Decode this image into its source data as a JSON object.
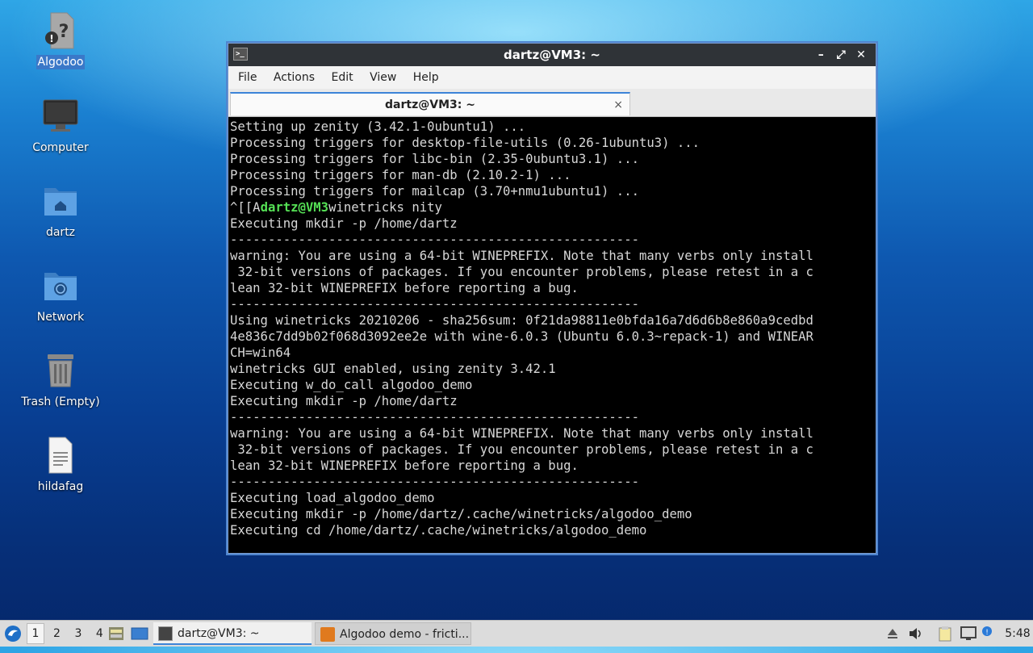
{
  "desktop": {
    "icons": [
      {
        "label": "Algodoo"
      },
      {
        "label": "Computer"
      },
      {
        "label": "dartz"
      },
      {
        "label": "Network"
      },
      {
        "label": "Trash (Empty)"
      },
      {
        "label": "hildafag"
      }
    ]
  },
  "window": {
    "title": "dartz@VM3: ~",
    "menu": [
      "File",
      "Actions",
      "Edit",
      "View",
      "Help"
    ],
    "tab_title": "dartz@VM3: ~",
    "tab_close": "×",
    "controls": {
      "minimize": "–",
      "maximize": "⤢",
      "close": "✕"
    }
  },
  "terminal": {
    "lines_before": [
      "Setting up zenity (3.42.1-0ubuntu1) ...",
      "Processing triggers for desktop-file-utils (0.26-1ubuntu3) ...",
      "Processing triggers for libc-bin (2.35-0ubuntu3.1) ...",
      "Processing triggers for man-db (2.10.2-1) ...",
      "Processing triggers for mailcap (3.70+nmu1ubuntu1) ..."
    ],
    "prompt_prefix": "^[[A",
    "prompt_user": "dartz@VM3",
    "prompt_cmd": "winetricks nity",
    "lines_after": [
      "Executing mkdir -p /home/dartz",
      "------------------------------------------------------",
      "warning: You are using a 64-bit WINEPREFIX. Note that many verbs only install",
      " 32-bit versions of packages. If you encounter problems, please retest in a c",
      "lean 32-bit WINEPREFIX before reporting a bug.",
      "------------------------------------------------------",
      "Using winetricks 20210206 - sha256sum: 0f21da98811e0bfda16a7d6d6b8e860a9cedbd",
      "4e836c7dd9b02f068d3092ee2e with wine-6.0.3 (Ubuntu 6.0.3~repack-1) and WINEAR",
      "CH=win64",
      "winetricks GUI enabled, using zenity 3.42.1",
      "Executing w_do_call algodoo_demo",
      "Executing mkdir -p /home/dartz",
      "------------------------------------------------------",
      "warning: You are using a 64-bit WINEPREFIX. Note that many verbs only install",
      " 32-bit versions of packages. If you encounter problems, please retest in a c",
      "lean 32-bit WINEPREFIX before reporting a bug.",
      "------------------------------------------------------",
      "Executing load_algodoo_demo",
      "Executing mkdir -p /home/dartz/.cache/winetricks/algodoo_demo",
      "Executing cd /home/dartz/.cache/winetricks/algodoo_demo"
    ]
  },
  "taskbar": {
    "workspaces": [
      "1",
      "2",
      "3",
      "4"
    ],
    "tasks": [
      {
        "label": "dartz@VM3: ~"
      },
      {
        "label": "Algodoo demo - fricti..."
      }
    ],
    "clock": "5:48"
  }
}
